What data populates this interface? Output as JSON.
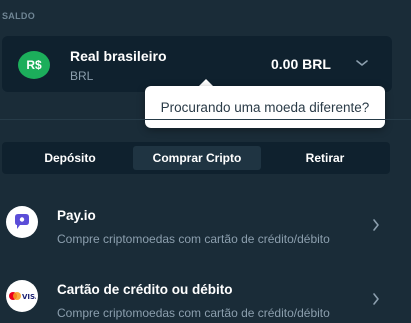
{
  "balance_section": {
    "label": "SALDO",
    "currency_badge": "R$",
    "currency_name": "Real brasileiro",
    "currency_code": "BRL",
    "amount": "0.00 BRL",
    "badge_color": "#1cae5b"
  },
  "tooltip": {
    "text": "Procurando uma moeda diferente?"
  },
  "tabs": [
    {
      "label": "Depósito",
      "active": false
    },
    {
      "label": "Comprar Cripto",
      "active": true
    },
    {
      "label": "Retirar",
      "active": false
    }
  ],
  "providers": [
    {
      "title": "Pay.io",
      "subtitle": "Compre criptomoedas com cartão de crédito/débito",
      "icon": "payio-logo-icon"
    },
    {
      "title": "Cartão de crédito ou débito",
      "subtitle": "Compre criptomoedas com cartão de crédito/débito",
      "icon": "mastercard-visa-icon"
    }
  ],
  "colors": {
    "background": "#1a2c38",
    "card": "#0f212e",
    "active_tab": "#1f3442",
    "muted_text": "#8c9fae"
  }
}
